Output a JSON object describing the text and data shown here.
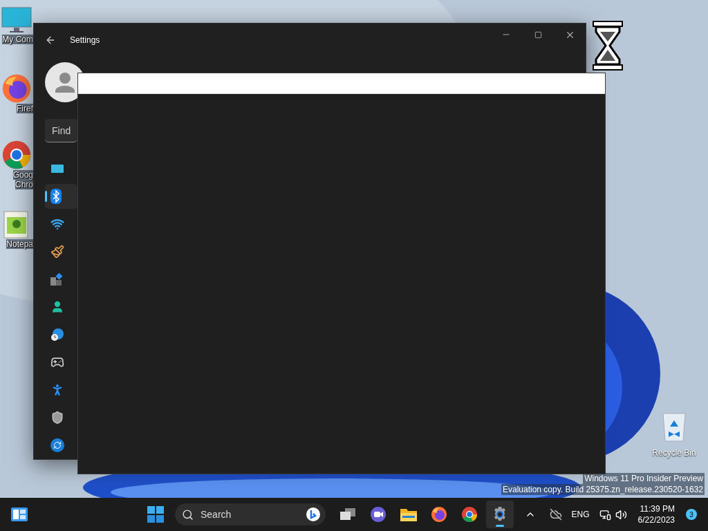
{
  "desktop_icons": [
    {
      "kind": "computer",
      "lines": [
        "My Com"
      ]
    },
    {
      "kind": "firefox",
      "lines": [
        "Firef"
      ]
    },
    {
      "kind": "chrome",
      "lines": [
        "Goog",
        "Chro"
      ]
    },
    {
      "kind": "notepad",
      "lines": [
        "Notepa"
      ]
    }
  ],
  "settings": {
    "title": "Settings",
    "search": {
      "placeholder": "Find"
    },
    "nav": [
      {
        "kind": "system",
        "selected": false
      },
      {
        "kind": "bluetooth",
        "selected": true
      },
      {
        "kind": "network",
        "selected": false
      },
      {
        "kind": "personalization",
        "selected": false
      },
      {
        "kind": "apps",
        "selected": false
      },
      {
        "kind": "accounts",
        "selected": false
      },
      {
        "kind": "time",
        "selected": false
      },
      {
        "kind": "gaming",
        "selected": false
      },
      {
        "kind": "accessibility",
        "selected": false
      },
      {
        "kind": "privacy",
        "selected": false
      },
      {
        "kind": "update",
        "selected": false
      }
    ]
  },
  "recycle_bin": {
    "label": "Recycle Bin"
  },
  "watermark": [
    "Windows 11 Pro Insider Preview",
    "Evaluation copy. Build 25375.zn_release.230520-1632"
  ],
  "taskbar": {
    "search": {
      "placeholder": "Search"
    },
    "apps": [
      {
        "kind": "taskview",
        "active": false
      },
      {
        "kind": "chat",
        "active": false
      },
      {
        "kind": "explorer",
        "active": false
      },
      {
        "kind": "firefox",
        "active": false
      },
      {
        "kind": "chrome",
        "active": false
      },
      {
        "kind": "settings",
        "active": true
      }
    ],
    "language": "ENG",
    "time": "11:39 PM",
    "date": "6/22/2023",
    "notifications": "3"
  }
}
